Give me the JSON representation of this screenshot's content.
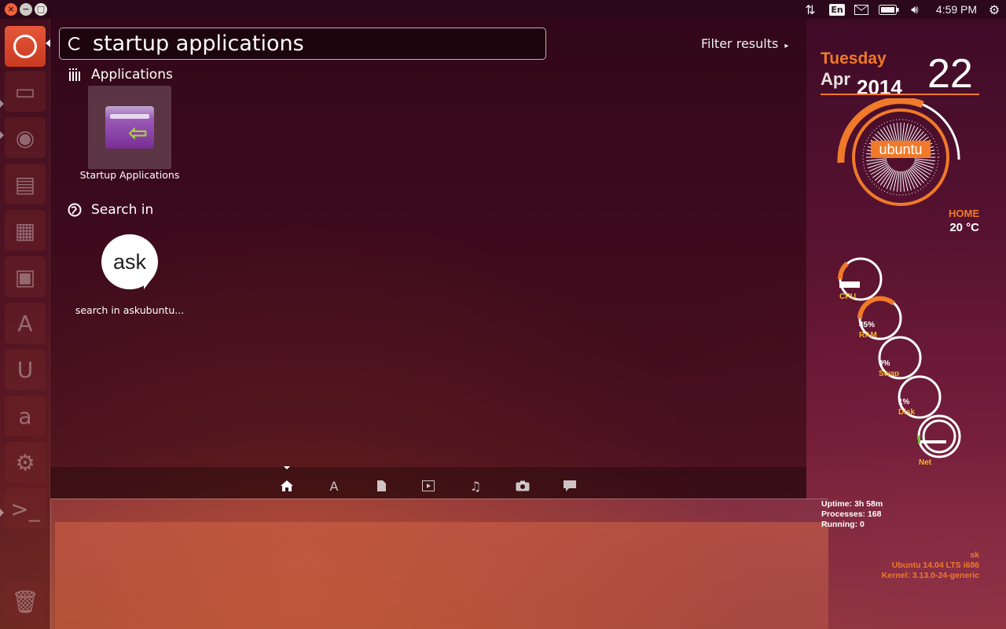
{
  "top_panel": {
    "clock": "4:59 PM",
    "keyboard_layout": "En",
    "icons": [
      "network-transfer-icon",
      "keyboard-icon",
      "mail-icon",
      "battery-icon",
      "volume-icon",
      "power-gear-icon"
    ]
  },
  "window_buttons": {
    "close": "×",
    "minimize": "−",
    "maximize": "□"
  },
  "launcher": {
    "items": [
      "dash-home",
      "files",
      "firefox",
      "writer",
      "calc",
      "impress",
      "software-center",
      "ubuntu-one",
      "amazon",
      "system-settings",
      "terminal",
      "trash"
    ]
  },
  "dash": {
    "search": {
      "value": "startup applications",
      "placeholder": ""
    },
    "filter_label": "Filter results",
    "filter_arrow": "▸",
    "categories": [
      {
        "label": "Applications",
        "results": [
          {
            "label": "Startup Applications"
          }
        ]
      },
      {
        "label": "Search in",
        "results": [
          {
            "label": "search in askubuntu...",
            "icon_text": "ask"
          }
        ]
      }
    ],
    "lenses": [
      "home",
      "applications",
      "files",
      "video",
      "music",
      "photos",
      "social"
    ]
  },
  "conky": {
    "day": "Tuesday",
    "month": "Apr",
    "year": "2014",
    "date": "22",
    "logo": "ubuntu",
    "location": "HOME",
    "temperature": "20 °C",
    "gauges": [
      {
        "label": "CPU",
        "value": "",
        "percent": 8
      },
      {
        "label": "RAM",
        "value": "45%",
        "percent": 45
      },
      {
        "label": "Swap",
        "value": "0%",
        "percent": 0
      },
      {
        "label": "Disk",
        "value": "1%",
        "percent": 1
      },
      {
        "label": "Net",
        "value": "",
        "percent": 0
      }
    ],
    "uptime": "Uptime: 3h 58m",
    "processes": "Processes: 168",
    "running": "Running: 0",
    "user": "sk",
    "os": "Ubuntu 14.04 LTS  i686",
    "kernel": "Kernel: 3.13.0-24-generic"
  },
  "colors": {
    "accent": "#f07a2a",
    "gauge_label": "#f5b52a",
    "launcher_active": "#e6573a"
  }
}
